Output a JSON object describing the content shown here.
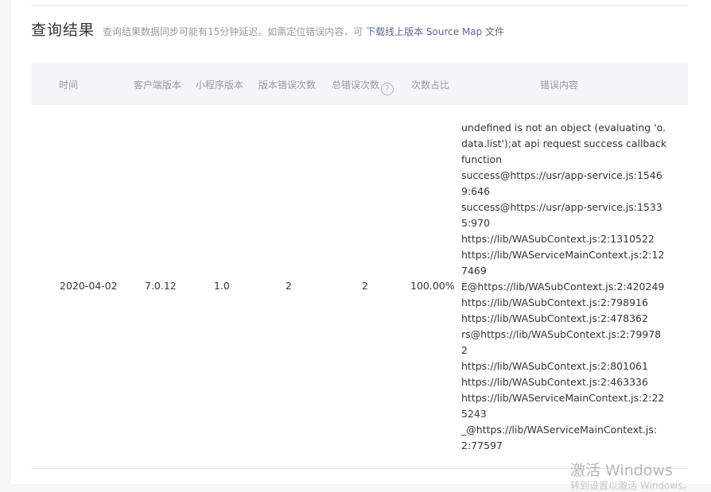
{
  "section": {
    "title": "查询结果",
    "description": "查询结果数据同步可能有15分钟延迟。如需定位错误内容，可 ",
    "link_label": "下载线上版本 Source Map 文件"
  },
  "table": {
    "columns": [
      "时间",
      "客户端版本",
      "小程序版本",
      "版本错误次数",
      "总错误次数",
      "次数占比",
      "错误内容"
    ],
    "help_icon_glyph": "?",
    "rows": [
      {
        "time": "2020-04-02",
        "client_version": "7.0.12",
        "miniprogram_version": "1.0",
        "version_error_count": "2",
        "total_error_count": "2",
        "ratio": "100.00%",
        "error_lines": [
          "undefined is not an object (evaluating 'o.",
          "data.list');at api request success callback",
          "function",
          "success@https://usr/app-service.js:1546",
          "9:646",
          "success@https://usr/app-service.js:1533",
          "5:970",
          "https://lib/WASubContext.js:2:1310522",
          "https://lib/WAServiceMainContext.js:2:12",
          "7469",
          "E@https://lib/WASubContext.js:2:420249",
          "https://lib/WASubContext.js:2:798916",
          "https://lib/WASubContext.js:2:478362",
          "rs@https://lib/WASubContext.js:2:79978",
          "2",
          "https://lib/WASubContext.js:2:801061",
          "https://lib/WASubContext.js:2:463336",
          "https://lib/WAServiceMainContext.js:2:22",
          "5243",
          "_@https://lib/WAServiceMainContext.js:",
          "2:77597"
        ]
      }
    ]
  },
  "watermark": {
    "title": "激活 Windows",
    "subtitle": "转到设置以激活 Windows。"
  }
}
